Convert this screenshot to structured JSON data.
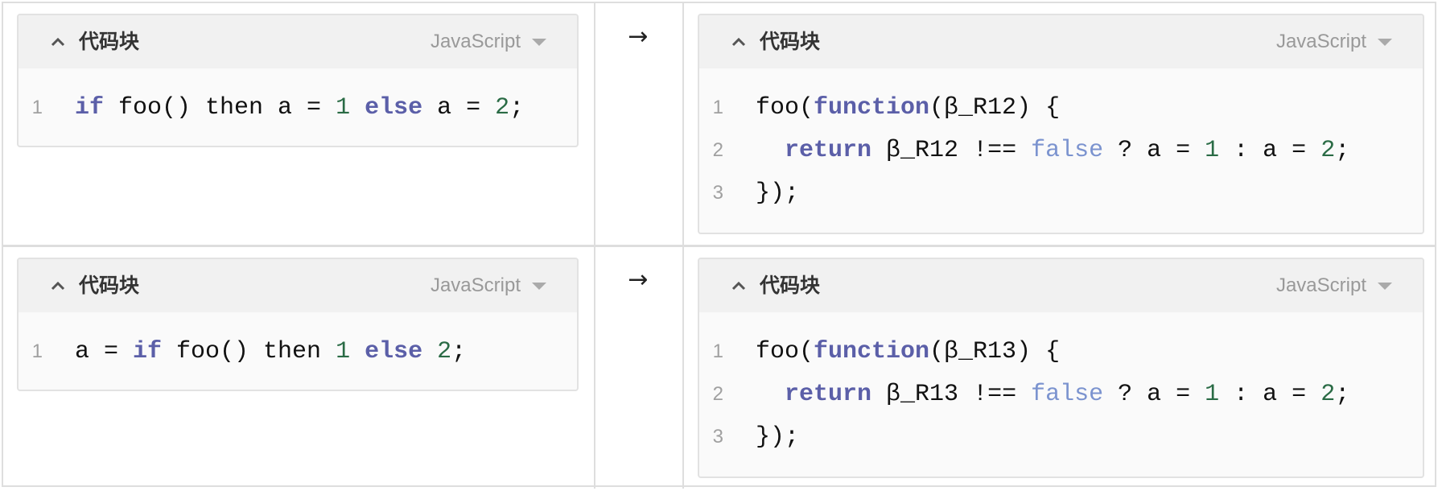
{
  "colors": {
    "keyword": "#5b5fa8",
    "number": "#2a6b45",
    "atom": "#7b93cf",
    "plain": "#111111",
    "line_number": "#a0a0a0",
    "header_bg": "#f1f1f1",
    "body_bg": "#fafafa",
    "border": "#dedede"
  },
  "arrow_symbol": "→",
  "rows": [
    {
      "input": {
        "title": "代码块",
        "language": "JavaScript",
        "lines": [
          {
            "number": "1",
            "tokens": [
              {
                "t": "if",
                "k": "kw"
              },
              {
                "t": " foo() then a = ",
                "k": "plain"
              },
              {
                "t": "1",
                "k": "num"
              },
              {
                "t": " ",
                "k": "plain"
              },
              {
                "t": "else",
                "k": "kw"
              },
              {
                "t": " a = ",
                "k": "plain"
              },
              {
                "t": "2",
                "k": "num"
              },
              {
                "t": ";",
                "k": "plain"
              }
            ]
          }
        ]
      },
      "arrow": "→",
      "output": {
        "title": "代码块",
        "language": "JavaScript",
        "lines": [
          {
            "number": "1",
            "tokens": [
              {
                "t": "foo(",
                "k": "plain"
              },
              {
                "t": "function",
                "k": "kw"
              },
              {
                "t": "(β_R12) {",
                "k": "plain"
              }
            ]
          },
          {
            "number": "2",
            "tokens": [
              {
                "t": "  ",
                "k": "plain"
              },
              {
                "t": "return",
                "k": "kw"
              },
              {
                "t": " β_R12 !== ",
                "k": "plain"
              },
              {
                "t": "false",
                "k": "atom"
              },
              {
                "t": " ? a = ",
                "k": "plain"
              },
              {
                "t": "1",
                "k": "num"
              },
              {
                "t": " : a = ",
                "k": "plain"
              },
              {
                "t": "2",
                "k": "num"
              },
              {
                "t": ";",
                "k": "plain"
              }
            ]
          },
          {
            "number": "3",
            "tokens": [
              {
                "t": "});",
                "k": "plain"
              }
            ]
          }
        ]
      }
    },
    {
      "input": {
        "title": "代码块",
        "language": "JavaScript",
        "lines": [
          {
            "number": "1",
            "tokens": [
              {
                "t": "a = ",
                "k": "plain"
              },
              {
                "t": "if",
                "k": "kw"
              },
              {
                "t": " foo() then ",
                "k": "plain"
              },
              {
                "t": "1",
                "k": "num"
              },
              {
                "t": " ",
                "k": "plain"
              },
              {
                "t": "else",
                "k": "kw"
              },
              {
                "t": " ",
                "k": "plain"
              },
              {
                "t": "2",
                "k": "num"
              },
              {
                "t": ";",
                "k": "plain"
              }
            ]
          }
        ]
      },
      "arrow": "→",
      "output": {
        "title": "代码块",
        "language": "JavaScript",
        "lines": [
          {
            "number": "1",
            "tokens": [
              {
                "t": "foo(",
                "k": "plain"
              },
              {
                "t": "function",
                "k": "kw"
              },
              {
                "t": "(β_R13) {",
                "k": "plain"
              }
            ]
          },
          {
            "number": "2",
            "tokens": [
              {
                "t": "  ",
                "k": "plain"
              },
              {
                "t": "return",
                "k": "kw"
              },
              {
                "t": " β_R13 !== ",
                "k": "plain"
              },
              {
                "t": "false",
                "k": "atom"
              },
              {
                "t": " ? a = ",
                "k": "plain"
              },
              {
                "t": "1",
                "k": "num"
              },
              {
                "t": " : a = ",
                "k": "plain"
              },
              {
                "t": "2",
                "k": "num"
              },
              {
                "t": ";",
                "k": "plain"
              }
            ]
          },
          {
            "number": "3",
            "tokens": [
              {
                "t": "});",
                "k": "plain"
              }
            ]
          }
        ]
      }
    }
  ]
}
